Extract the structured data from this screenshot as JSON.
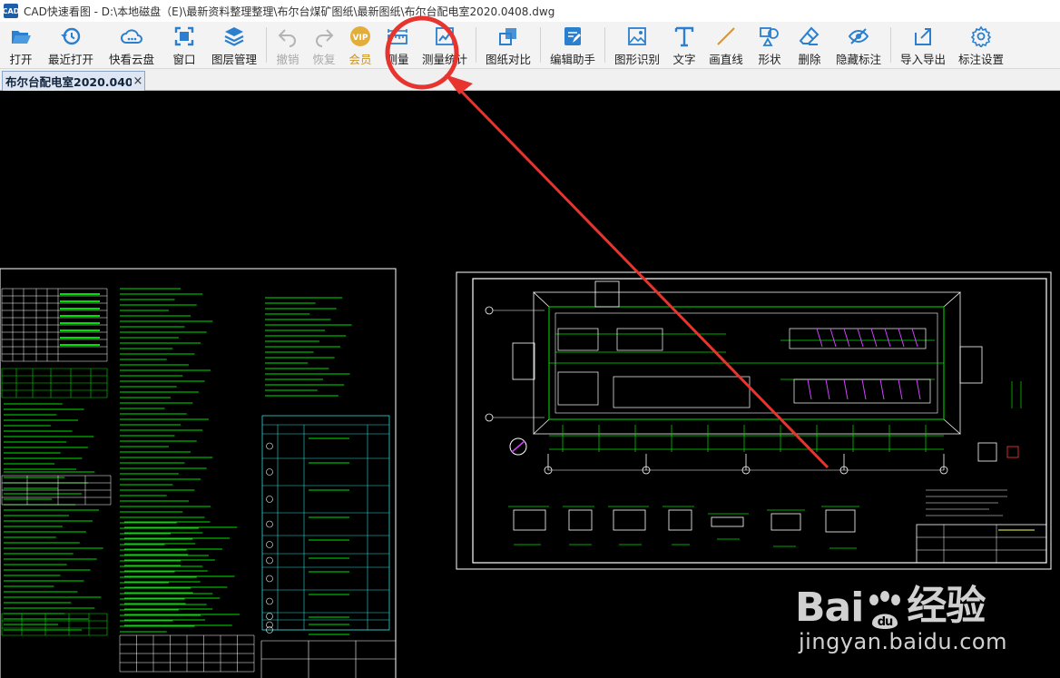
{
  "window": {
    "title": "CAD快速看图 - D:\\本地磁盘（E)\\最新资料整理整理\\布尔台煤矿图纸\\最新图纸\\布尔台配电室2020.0408.dwg",
    "icon_label": "CAD"
  },
  "toolbar": {
    "open": "打开",
    "recent": "最近打开",
    "cloud": "快看云盘",
    "window": "窗口",
    "layers": "图层管理",
    "undo": "撤销",
    "redo": "恢复",
    "vip": "会员",
    "vip_badge": "VIP",
    "measure": "测量",
    "measure_stats": "测量统计",
    "compare": "图纸对比",
    "edit_helper": "编辑助手",
    "shape_recognize": "图形识别",
    "text": "文字",
    "draw_line": "画直线",
    "shape": "形状",
    "delete": "删除",
    "hide_annotation": "隐藏标注",
    "import_export": "导入导出",
    "annotation_settings": "标注设置"
  },
  "tabs": [
    {
      "label": "布尔台配电室2020.040",
      "close": "×"
    }
  ],
  "watermark": {
    "logo_left": "Bai",
    "logo_right": "经验",
    "paw_text": "du",
    "url": "jingyan.baidu.com"
  },
  "colors": {
    "annotation": "#e8342e",
    "cad_green": "#00e000",
    "cad_white": "#ffffff",
    "cad_cyan": "#33d6d6",
    "cad_magenta": "#d040ff",
    "toolbar_icon": "#2b7fcf"
  }
}
